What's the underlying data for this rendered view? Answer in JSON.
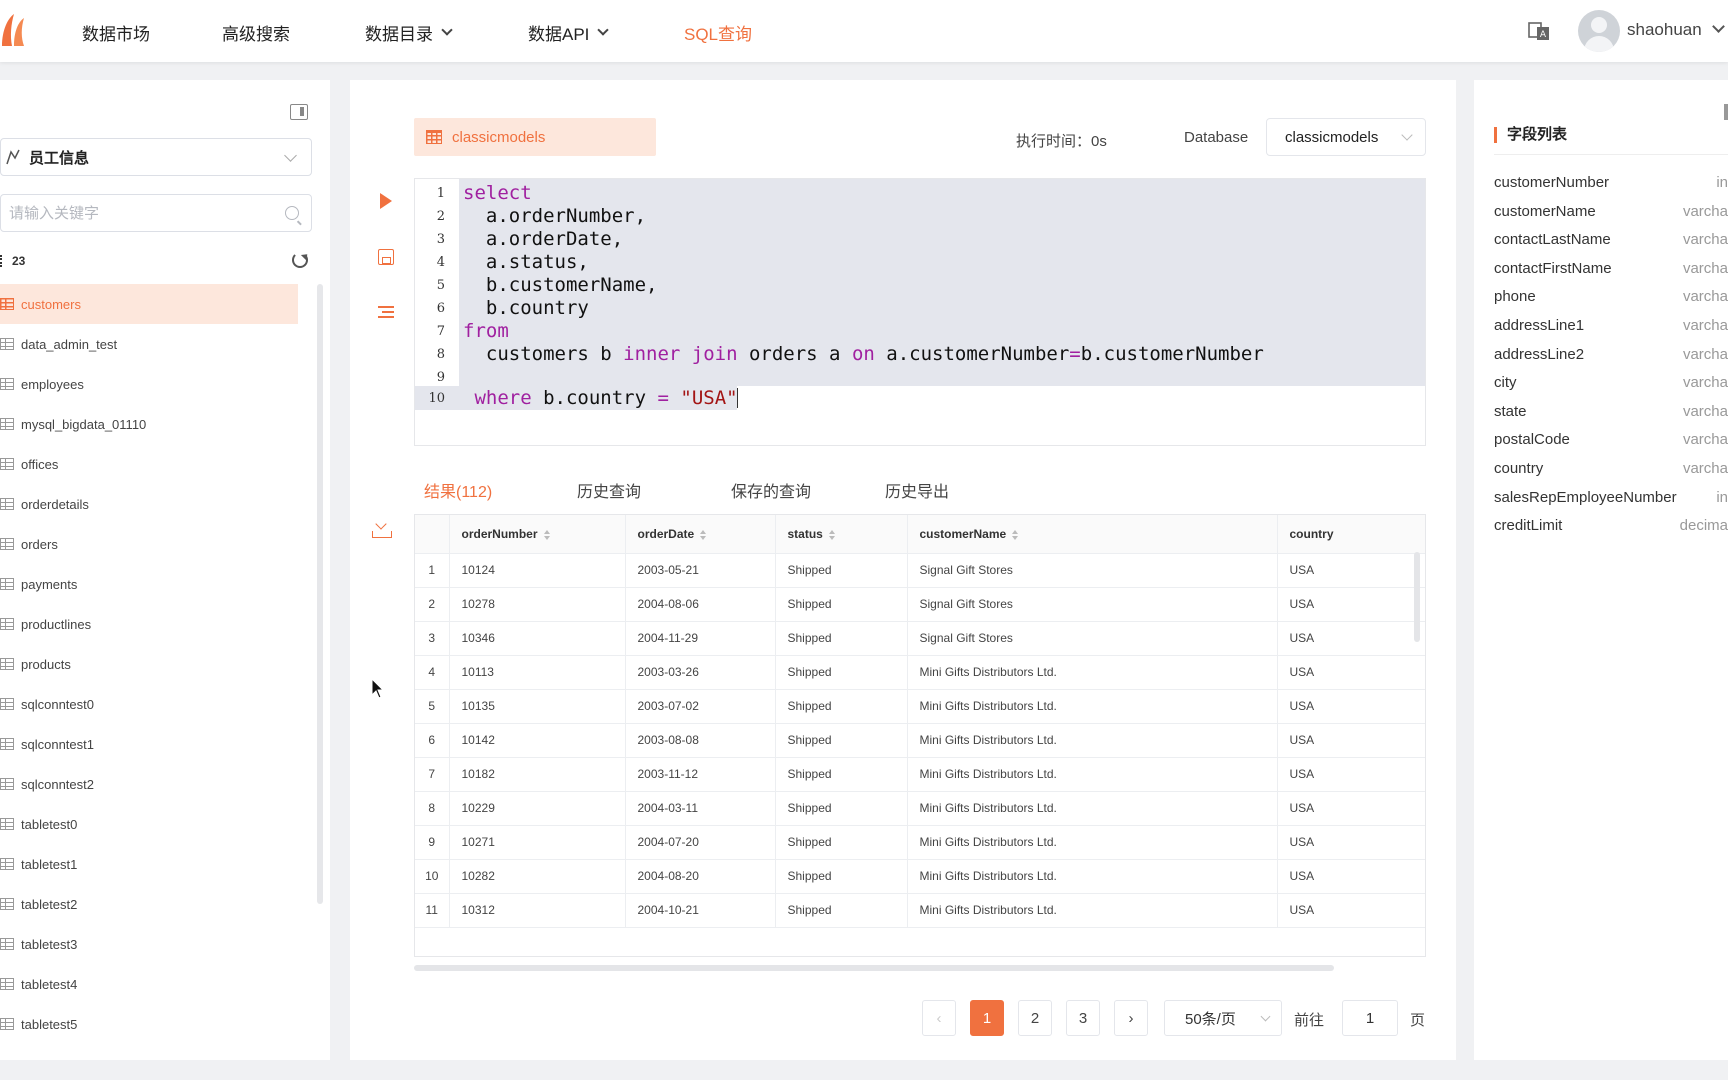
{
  "nav": {
    "items": [
      {
        "label": "数据市场",
        "has_dropdown": false,
        "active": false
      },
      {
        "label": "高级搜索",
        "has_dropdown": false,
        "active": false
      },
      {
        "label": "数据目录",
        "has_dropdown": true,
        "active": false
      },
      {
        "label": "数据API",
        "has_dropdown": true,
        "active": false
      },
      {
        "label": "SQL查询",
        "has_dropdown": false,
        "active": true
      }
    ],
    "username": "shaohuan",
    "icons": [
      "logo-icon",
      "translate-icon",
      "avatar",
      "chevron-down-icon"
    ]
  },
  "sidebar": {
    "database_select": "员工信息",
    "search_placeholder": "请输入关键字",
    "table_count": "23",
    "tables": [
      {
        "name": "customers",
        "selected": true
      },
      {
        "name": "data_admin_test",
        "selected": false
      },
      {
        "name": "employees",
        "selected": false
      },
      {
        "name": "mysql_bigdata_01110",
        "selected": false
      },
      {
        "name": "offices",
        "selected": false
      },
      {
        "name": "orderdetails",
        "selected": false
      },
      {
        "name": "orders",
        "selected": false
      },
      {
        "name": "payments",
        "selected": false
      },
      {
        "name": "productlines",
        "selected": false
      },
      {
        "name": "products",
        "selected": false
      },
      {
        "name": "sqlconntest0",
        "selected": false
      },
      {
        "name": "sqlconntest1",
        "selected": false
      },
      {
        "name": "sqlconntest2",
        "selected": false
      },
      {
        "name": "tabletest0",
        "selected": false
      },
      {
        "name": "tabletest1",
        "selected": false
      },
      {
        "name": "tabletest2",
        "selected": false
      },
      {
        "name": "tabletest3",
        "selected": false
      },
      {
        "name": "tabletest4",
        "selected": false
      },
      {
        "name": "tabletest5",
        "selected": false
      }
    ]
  },
  "main": {
    "tab_name": "classicmodels",
    "exec_time": "执行时间：0s",
    "database_label": "Database",
    "database_value": "classicmodels",
    "editor_lines": [
      {
        "n": "1",
        "tokens": [
          {
            "t": "select",
            "k": "kw"
          }
        ]
      },
      {
        "n": "2",
        "tokens": [
          {
            "t": "  a.orderNumber,",
            "k": ""
          }
        ]
      },
      {
        "n": "3",
        "tokens": [
          {
            "t": "  a.orderDate,",
            "k": ""
          }
        ]
      },
      {
        "n": "4",
        "tokens": [
          {
            "t": "  a.status,",
            "k": ""
          }
        ]
      },
      {
        "n": "5",
        "tokens": [
          {
            "t": "  b.customerName,",
            "k": ""
          }
        ]
      },
      {
        "n": "6",
        "tokens": [
          {
            "t": "  b.country",
            "k": ""
          }
        ]
      },
      {
        "n": "7",
        "tokens": [
          {
            "t": "from",
            "k": "kw"
          }
        ]
      },
      {
        "n": "8",
        "tokens": [
          {
            "t": "  customers b ",
            "k": ""
          },
          {
            "t": "inner join",
            "k": "kw"
          },
          {
            "t": " orders a ",
            "k": ""
          },
          {
            "t": "on",
            "k": "kw"
          },
          {
            "t": " a.customerNumber",
            "k": ""
          },
          {
            "t": "=",
            "k": "kw"
          },
          {
            "t": "b.customerNumber",
            "k": ""
          }
        ]
      },
      {
        "n": "9",
        "tokens": []
      },
      {
        "n": "10",
        "tokens": [
          {
            "t": " ",
            "k": ""
          },
          {
            "t": "where",
            "k": "kw"
          },
          {
            "t": " b.country ",
            "k": ""
          },
          {
            "t": "=",
            "k": "kw"
          },
          {
            "t": " ",
            "k": ""
          },
          {
            "t": "\"USA\"",
            "k": "str"
          }
        ]
      }
    ],
    "result_tabs": [
      {
        "label": "结果(112)",
        "active": true
      },
      {
        "label": "历史查询",
        "active": false
      },
      {
        "label": "保存的查询",
        "active": false
      },
      {
        "label": "历史导出",
        "active": false
      }
    ],
    "columns": [
      "orderNumber",
      "orderDate",
      "status",
      "customerName",
      "country"
    ],
    "rows": [
      [
        "1",
        "10124",
        "2003-05-21",
        "Shipped",
        "Signal Gift Stores",
        "USA"
      ],
      [
        "2",
        "10278",
        "2004-08-06",
        "Shipped",
        "Signal Gift Stores",
        "USA"
      ],
      [
        "3",
        "10346",
        "2004-11-29",
        "Shipped",
        "Signal Gift Stores",
        "USA"
      ],
      [
        "4",
        "10113",
        "2003-03-26",
        "Shipped",
        "Mini Gifts Distributors Ltd.",
        "USA"
      ],
      [
        "5",
        "10135",
        "2003-07-02",
        "Shipped",
        "Mini Gifts Distributors Ltd.",
        "USA"
      ],
      [
        "6",
        "10142",
        "2003-08-08",
        "Shipped",
        "Mini Gifts Distributors Ltd.",
        "USA"
      ],
      [
        "7",
        "10182",
        "2003-11-12",
        "Shipped",
        "Mini Gifts Distributors Ltd.",
        "USA"
      ],
      [
        "8",
        "10229",
        "2004-03-11",
        "Shipped",
        "Mini Gifts Distributors Ltd.",
        "USA"
      ],
      [
        "9",
        "10271",
        "2004-07-20",
        "Shipped",
        "Mini Gifts Distributors Ltd.",
        "USA"
      ],
      [
        "10",
        "10282",
        "2004-08-20",
        "Shipped",
        "Mini Gifts Distributors Ltd.",
        "USA"
      ],
      [
        "11",
        "10312",
        "2004-10-21",
        "Shipped",
        "Mini Gifts Distributors Ltd.",
        "USA"
      ]
    ],
    "pagination": {
      "pages": [
        "1",
        "2",
        "3"
      ],
      "current": "1",
      "prev": "‹",
      "next": "›",
      "page_size": "50条/页",
      "goto_label": "前往",
      "goto_value": "1",
      "page_suffix": "页"
    }
  },
  "fields_panel": {
    "title": "字段列表",
    "fields": [
      {
        "name": "customerNumber",
        "type": "in"
      },
      {
        "name": "customerName",
        "type": "varcha"
      },
      {
        "name": "contactLastName",
        "type": "varcha"
      },
      {
        "name": "contactFirstName",
        "type": "varcha"
      },
      {
        "name": "phone",
        "type": "varcha"
      },
      {
        "name": "addressLine1",
        "type": "varcha"
      },
      {
        "name": "addressLine2",
        "type": "varcha"
      },
      {
        "name": "city",
        "type": "varcha"
      },
      {
        "name": "state",
        "type": "varcha"
      },
      {
        "name": "postalCode",
        "type": "varcha"
      },
      {
        "name": "country",
        "type": "varcha"
      },
      {
        "name": "salesRepEmployeeNumber",
        "type": "in"
      },
      {
        "name": "creditLimit",
        "type": "decima"
      }
    ]
  },
  "colors": {
    "accent": "#f0713f",
    "accent_light": "#fde7dc",
    "keyword": "#a020a0",
    "string": "#a31515"
  }
}
